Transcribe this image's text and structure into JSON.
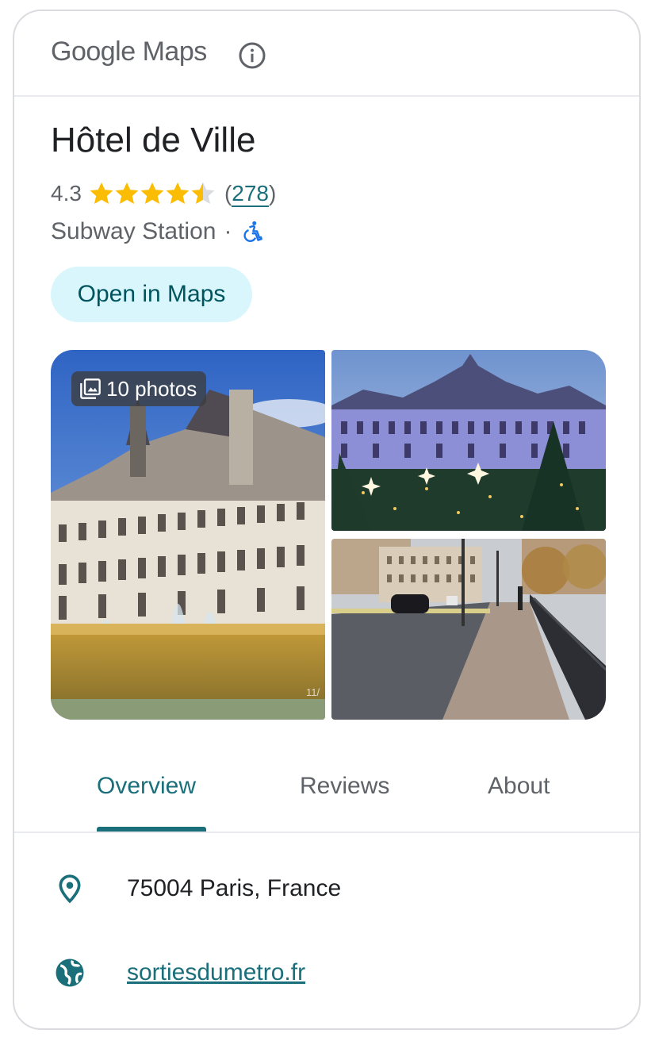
{
  "header": {
    "logo_brand": "Google",
    "logo_product": "Maps",
    "info_icon": "info-icon"
  },
  "place": {
    "name": "Hôtel de Ville",
    "rating": "4.3",
    "rating_value": 4.3,
    "review_count_open": "(",
    "review_count": "278",
    "review_count_close": ")",
    "type": "Subway Station",
    "separator": "·",
    "accessibility_icon": "wheelchair-icon"
  },
  "actions": {
    "open_in_maps": "Open in Maps"
  },
  "photos": {
    "count_label": "10 photos",
    "watermark": "11/"
  },
  "tabs": [
    {
      "label": "Overview",
      "active": true
    },
    {
      "label": "Reviews",
      "active": false
    },
    {
      "label": "About",
      "active": false
    }
  ],
  "details": {
    "address": "75004 Paris, France",
    "website": "sortiesdumetro.fr"
  },
  "colors": {
    "accent": "#1a6f7a",
    "button_bg": "#d8f6fc",
    "star": "#fbbc04",
    "star_empty": "#dadce0"
  }
}
